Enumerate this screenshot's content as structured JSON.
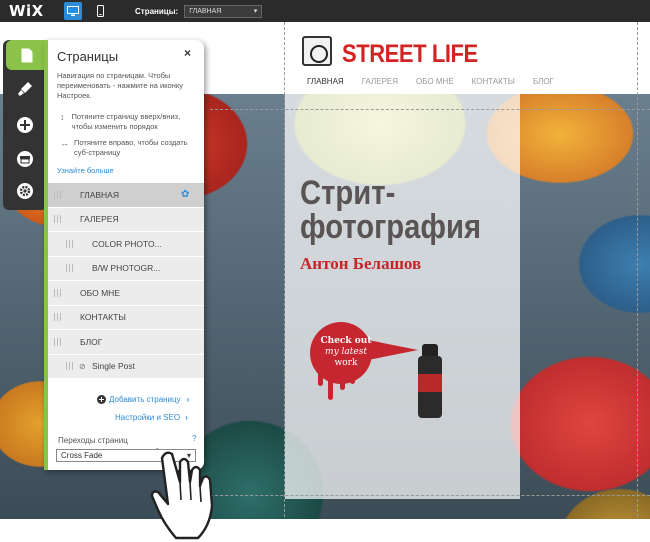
{
  "topbar": {
    "logo": "WiX",
    "pages_label": "Страницы:",
    "current_page": "ГЛАВНАЯ"
  },
  "site": {
    "brand": "STREET LIFE",
    "nav": [
      "ГЛАВНАЯ",
      "ГАЛЕРЕЯ",
      "ОБО МНЕ",
      "КОНТАКТЫ",
      "БЛОГ"
    ],
    "hero_title_line1": "Стрит-",
    "hero_title_line2": "фотография",
    "hero_author": "Антон Белашов",
    "bubble_line1": "Check out",
    "bubble_line2": "my latest",
    "bubble_line3": "work"
  },
  "panel": {
    "title": "Страницы",
    "close": "×",
    "description": "Навигация по страницам. Чтобы переименовать - нажмите на иконку Настроек.",
    "hint1": "Потяните страницу вверх/вниз, чтобы изменить порядок",
    "hint2": "Потяните вправо, чтобы создать суб-страницу",
    "learn_more": "Узнайте больше",
    "pages": [
      {
        "label": "ГЛАВНАЯ"
      },
      {
        "label": "ГАЛЕРЕЯ"
      },
      {
        "label": "COLOR PHOTO..."
      },
      {
        "label": "B/W PHOTOGR..."
      },
      {
        "label": "ОБО МНЕ"
      },
      {
        "label": "КОНТАКТЫ"
      },
      {
        "label": "БЛОГ"
      },
      {
        "label": "Single Post"
      }
    ],
    "add_page": "Добавить страницу",
    "settings_seo": "Настройки и SEO",
    "transitions_label": "Переходы страниц",
    "transitions_help": "?",
    "transitions_value": "Cross Fade"
  },
  "colors": {
    "accent_green": "#8bc34a",
    "link_blue": "#2e8bd8",
    "brand_red": "#d32424"
  }
}
